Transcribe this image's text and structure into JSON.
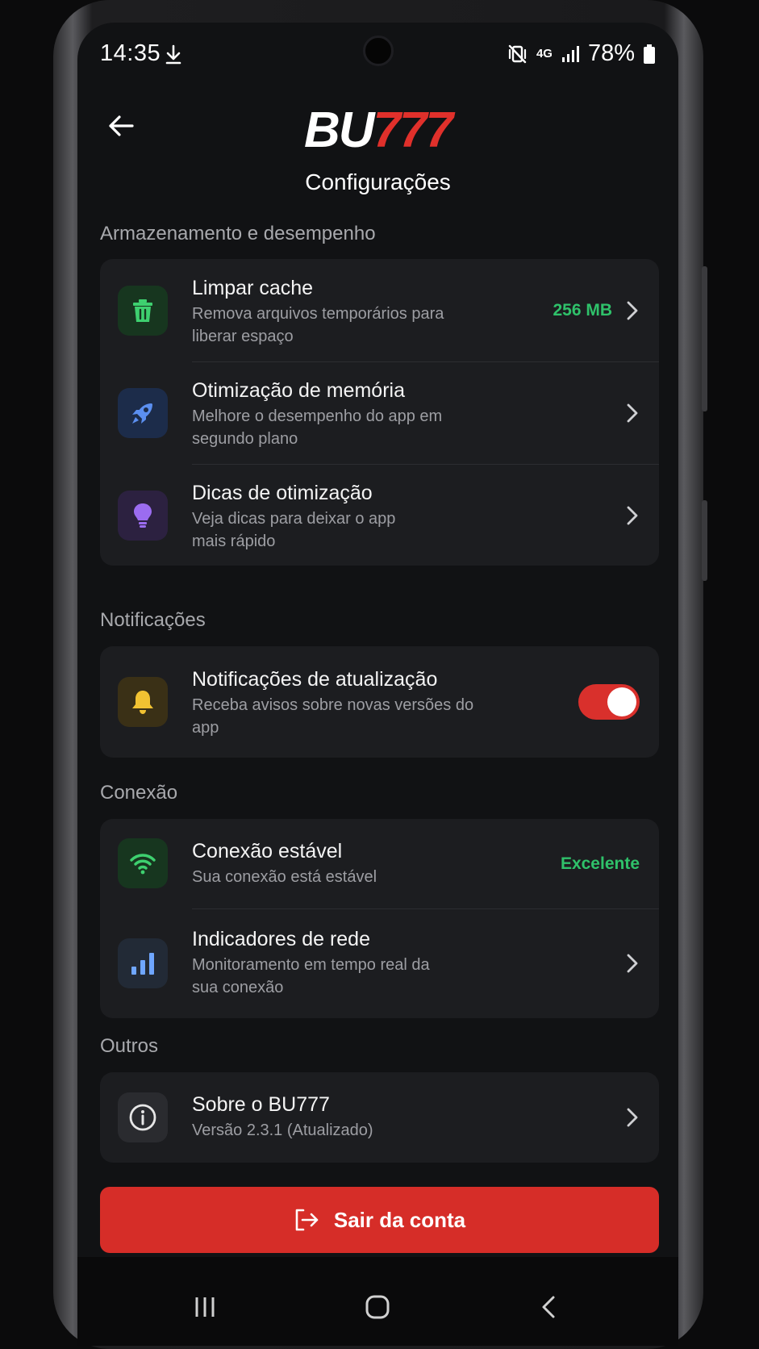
{
  "status_bar": {
    "time": "14:35",
    "network": "4G",
    "battery": "78%"
  },
  "header": {
    "logo_text": "BU",
    "logo_number": "777",
    "title": "Configurações"
  },
  "sections": {
    "storage": {
      "label": "Armazenamento e desempenho",
      "items": [
        {
          "title": "Limpar cache",
          "subtitle": "Remova arquivos temporários para liberar espaço",
          "value": "256 MB",
          "icon": "trash-icon"
        },
        {
          "title": "Otimização de memória",
          "subtitle": "Melhore o desempenho do app em segundo plano",
          "icon": "rocket-icon"
        },
        {
          "title": "Dicas de otimização",
          "subtitle": "Veja dicas para deixar o app mais rápido",
          "icon": "lightbulb-icon"
        }
      ]
    },
    "notifications": {
      "label": "Notificações",
      "items": [
        {
          "title": "Notificações de atualização",
          "subtitle": "Receba avisos sobre novas versões do app",
          "toggle": true,
          "icon": "bell-icon"
        }
      ]
    },
    "connection": {
      "label": "Conexão",
      "items": [
        {
          "title": "Conexão estável",
          "subtitle": "Sua conexão está estável",
          "value": "Excelente",
          "icon": "wifi-icon"
        },
        {
          "title": "Indicadores de rede",
          "subtitle": "Monitoramento em tempo real da sua conexão",
          "icon": "bar-chart-icon"
        }
      ]
    },
    "others": {
      "label": "Outros",
      "items": [
        {
          "title": "Sobre o BU777",
          "subtitle": "Versão 2.3.1 (Atualizado)",
          "icon": "info-icon"
        }
      ]
    }
  },
  "logout_label": "Sair da conta",
  "colors": {
    "accent_red": "#d62d28",
    "value_green": "#2fc16a",
    "background": "#111214",
    "card": "#1c1d20"
  }
}
